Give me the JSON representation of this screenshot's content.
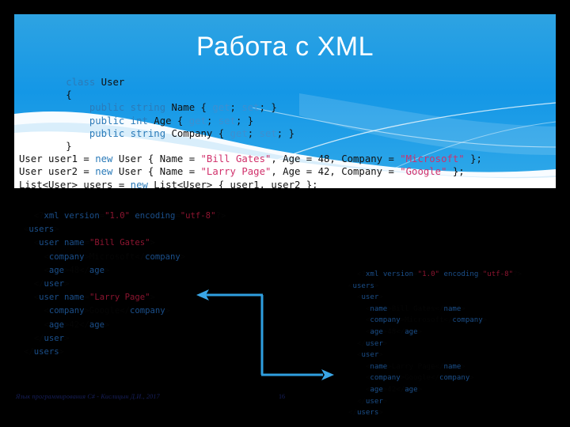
{
  "slide": {
    "title": "Работа с XML",
    "accent_blue": "#189ae4",
    "background": "#000000"
  },
  "code": {
    "language": "csharp",
    "lines": [
      [
        {
          "t": "        ",
          "c": "plain"
        },
        {
          "t": "class",
          "c": "kw"
        },
        {
          "t": " User",
          "c": "plain"
        }
      ],
      [
        {
          "t": "        {",
          "c": "plain"
        }
      ],
      [
        {
          "t": "            ",
          "c": "plain"
        },
        {
          "t": "public",
          "c": "kw"
        },
        {
          "t": " ",
          "c": "plain"
        },
        {
          "t": "string",
          "c": "kw"
        },
        {
          "t": " Name { ",
          "c": "plain"
        },
        {
          "t": "get",
          "c": "kw2"
        },
        {
          "t": "; ",
          "c": "plain"
        },
        {
          "t": "set",
          "c": "kw2"
        },
        {
          "t": "; }",
          "c": "plain"
        }
      ],
      [
        {
          "t": "            ",
          "c": "plain"
        },
        {
          "t": "public",
          "c": "kw"
        },
        {
          "t": " ",
          "c": "plain"
        },
        {
          "t": "int",
          "c": "kw"
        },
        {
          "t": " Age { ",
          "c": "plain"
        },
        {
          "t": "get",
          "c": "kw2"
        },
        {
          "t": "; ",
          "c": "plain"
        },
        {
          "t": "set",
          "c": "kw2"
        },
        {
          "t": "; }",
          "c": "plain"
        }
      ],
      [
        {
          "t": "            ",
          "c": "plain"
        },
        {
          "t": "public",
          "c": "kw"
        },
        {
          "t": " ",
          "c": "plain"
        },
        {
          "t": "string",
          "c": "kw"
        },
        {
          "t": " Company { ",
          "c": "plain"
        },
        {
          "t": "get",
          "c": "kw2"
        },
        {
          "t": "; ",
          "c": "plain"
        },
        {
          "t": "set",
          "c": "kw2"
        },
        {
          "t": "; }",
          "c": "plain"
        }
      ],
      [
        {
          "t": "        }",
          "c": "plain"
        }
      ],
      [
        {
          "t": "User user1 = ",
          "c": "plain"
        },
        {
          "t": "new",
          "c": "kw"
        },
        {
          "t": " User { Name = ",
          "c": "plain"
        },
        {
          "t": "\"Bill Gates\"",
          "c": "str"
        },
        {
          "t": ", Age = 48, Company = ",
          "c": "plain"
        },
        {
          "t": "\"Microsoft\"",
          "c": "str"
        },
        {
          "t": " };",
          "c": "plain"
        }
      ],
      [
        {
          "t": "User user2 = ",
          "c": "plain"
        },
        {
          "t": "new",
          "c": "kw"
        },
        {
          "t": " User { Name = ",
          "c": "plain"
        },
        {
          "t": "\"Larry Page\"",
          "c": "str"
        },
        {
          "t": ", Age = 42, Company = ",
          "c": "plain"
        },
        {
          "t": "\"Google\"",
          "c": "str"
        },
        {
          "t": " };",
          "c": "plain"
        }
      ],
      [
        {
          "t": "List<User> users = ",
          "c": "plain"
        },
        {
          "t": "new",
          "c": "kw"
        },
        {
          "t": " List<User> { user1, user2 };",
          "c": "plain"
        }
      ]
    ]
  },
  "xml_left": {
    "label": "source-xml",
    "lines": [
      [
        {
          "t": "  <?",
          "c": "punct"
        },
        {
          "t": "xml",
          "c": "tag"
        },
        {
          "t": " ",
          "c": "punct"
        },
        {
          "t": "version",
          "c": "attr"
        },
        {
          "t": "=",
          "c": "punct"
        },
        {
          "t": "\"1.0\"",
          "c": "xstr"
        },
        {
          "t": " ",
          "c": "punct"
        },
        {
          "t": "encoding",
          "c": "attr"
        },
        {
          "t": "=",
          "c": "punct"
        },
        {
          "t": "\"utf-8\"",
          "c": "xstr"
        },
        {
          "t": "?>",
          "c": "punct"
        }
      ],
      [
        {
          "t": "<",
          "c": "punct"
        },
        {
          "t": "users",
          "c": "tag"
        },
        {
          "t": ">",
          "c": "punct"
        }
      ],
      [
        {
          "t": "  <",
          "c": "punct"
        },
        {
          "t": "user",
          "c": "tag"
        },
        {
          "t": " ",
          "c": "punct"
        },
        {
          "t": "name",
          "c": "attr"
        },
        {
          "t": "=",
          "c": "punct"
        },
        {
          "t": "\"Bill Gates\"",
          "c": "xstr"
        },
        {
          "t": ">",
          "c": "punct"
        }
      ],
      [
        {
          "t": "    <",
          "c": "punct"
        },
        {
          "t": "company",
          "c": "tag"
        },
        {
          "t": ">Microsoft</",
          "c": "punct"
        },
        {
          "t": "company",
          "c": "tag"
        },
        {
          "t": ">",
          "c": "punct"
        }
      ],
      [
        {
          "t": "    <",
          "c": "punct"
        },
        {
          "t": "age",
          "c": "tag"
        },
        {
          "t": ">48</",
          "c": "punct"
        },
        {
          "t": "age",
          "c": "tag"
        },
        {
          "t": ">",
          "c": "punct"
        }
      ],
      [
        {
          "t": "  </",
          "c": "punct"
        },
        {
          "t": "user",
          "c": "tag"
        },
        {
          "t": ">",
          "c": "punct"
        }
      ],
      [
        {
          "t": "  <",
          "c": "punct"
        },
        {
          "t": "user",
          "c": "tag"
        },
        {
          "t": " ",
          "c": "punct"
        },
        {
          "t": "name",
          "c": "attr"
        },
        {
          "t": "=",
          "c": "punct"
        },
        {
          "t": "\"Larry Page\"",
          "c": "xstr"
        },
        {
          "t": ">",
          "c": "punct"
        }
      ],
      [
        {
          "t": "    <",
          "c": "punct"
        },
        {
          "t": "company",
          "c": "tag"
        },
        {
          "t": ">Google</",
          "c": "punct"
        },
        {
          "t": "company",
          "c": "tag"
        },
        {
          "t": ">",
          "c": "punct"
        }
      ],
      [
        {
          "t": "    <",
          "c": "punct"
        },
        {
          "t": "age",
          "c": "tag"
        },
        {
          "t": ">42</",
          "c": "punct"
        },
        {
          "t": "age",
          "c": "tag"
        },
        {
          "t": ">",
          "c": "punct"
        }
      ],
      [
        {
          "t": "  </",
          "c": "punct"
        },
        {
          "t": "user",
          "c": "tag"
        },
        {
          "t": ">",
          "c": "punct"
        }
      ],
      [
        {
          "t": "</",
          "c": "punct"
        },
        {
          "t": "users",
          "c": "tag"
        },
        {
          "t": ">",
          "c": "punct"
        }
      ]
    ]
  },
  "xml_right": {
    "label": "result-xml",
    "lines": [
      [
        {
          "t": "  <?",
          "c": "punct"
        },
        {
          "t": "xml",
          "c": "tag"
        },
        {
          "t": " ",
          "c": "punct"
        },
        {
          "t": "version",
          "c": "attr"
        },
        {
          "t": "=",
          "c": "punct"
        },
        {
          "t": "\"1.0\"",
          "c": "xstr"
        },
        {
          "t": " ",
          "c": "punct"
        },
        {
          "t": "encoding",
          "c": "attr"
        },
        {
          "t": "=",
          "c": "punct"
        },
        {
          "t": "\"utf-8\"",
          "c": "xstr"
        },
        {
          "t": "?>",
          "c": "punct"
        }
      ],
      [
        {
          "t": "<",
          "c": "punct"
        },
        {
          "t": "users",
          "c": "tag"
        },
        {
          "t": ">",
          "c": "punct"
        }
      ],
      [
        {
          "t": "  <",
          "c": "punct"
        },
        {
          "t": "user",
          "c": "tag"
        },
        {
          "t": ">",
          "c": "punct"
        }
      ],
      [
        {
          "t": "    <",
          "c": "punct"
        },
        {
          "t": "name",
          "c": "tag"
        },
        {
          "t": ">Bill Gates</",
          "c": "punct"
        },
        {
          "t": "name",
          "c": "tag"
        },
        {
          "t": ">",
          "c": "punct"
        }
      ],
      [
        {
          "t": "    <",
          "c": "punct"
        },
        {
          "t": "company",
          "c": "tag"
        },
        {
          "t": ">Microsoft</",
          "c": "punct"
        },
        {
          "t": "company",
          "c": "tag"
        },
        {
          "t": ">",
          "c": "punct"
        }
      ],
      [
        {
          "t": "    <",
          "c": "punct"
        },
        {
          "t": "age",
          "c": "tag"
        },
        {
          "t": ">48</",
          "c": "punct"
        },
        {
          "t": "age",
          "c": "tag"
        },
        {
          "t": ">",
          "c": "punct"
        }
      ],
      [
        {
          "t": "  </",
          "c": "punct"
        },
        {
          "t": "user",
          "c": "tag"
        },
        {
          "t": ">",
          "c": "punct"
        }
      ],
      [
        {
          "t": "  <",
          "c": "punct"
        },
        {
          "t": "user",
          "c": "tag"
        },
        {
          "t": ">",
          "c": "punct"
        }
      ],
      [
        {
          "t": "    <",
          "c": "punct"
        },
        {
          "t": "name",
          "c": "tag"
        },
        {
          "t": ">Larry Page</",
          "c": "punct"
        },
        {
          "t": "name",
          "c": "tag"
        },
        {
          "t": ">",
          "c": "punct"
        }
      ],
      [
        {
          "t": "    <",
          "c": "punct"
        },
        {
          "t": "company",
          "c": "tag"
        },
        {
          "t": ">Google</",
          "c": "punct"
        },
        {
          "t": "company",
          "c": "tag"
        },
        {
          "t": ">",
          "c": "punct"
        }
      ],
      [
        {
          "t": "    <",
          "c": "punct"
        },
        {
          "t": "age",
          "c": "tag"
        },
        {
          "t": ">42</",
          "c": "punct"
        },
        {
          "t": "age",
          "c": "tag"
        },
        {
          "t": ">",
          "c": "punct"
        }
      ],
      [
        {
          "t": "  </",
          "c": "punct"
        },
        {
          "t": "user",
          "c": "tag"
        },
        {
          "t": ">",
          "c": "punct"
        }
      ],
      [
        {
          "t": "</",
          "c": "punct"
        },
        {
          "t": "users",
          "c": "tag"
        },
        {
          "t": ">",
          "c": "punct"
        }
      ]
    ]
  },
  "arrow": {
    "name": "double-headed-connector",
    "color": "#2f9fe0"
  },
  "footer": {
    "credit": "Язык программирования C# - Кислицын Д.И., 2017",
    "page": "16",
    "color": "#17205e"
  }
}
